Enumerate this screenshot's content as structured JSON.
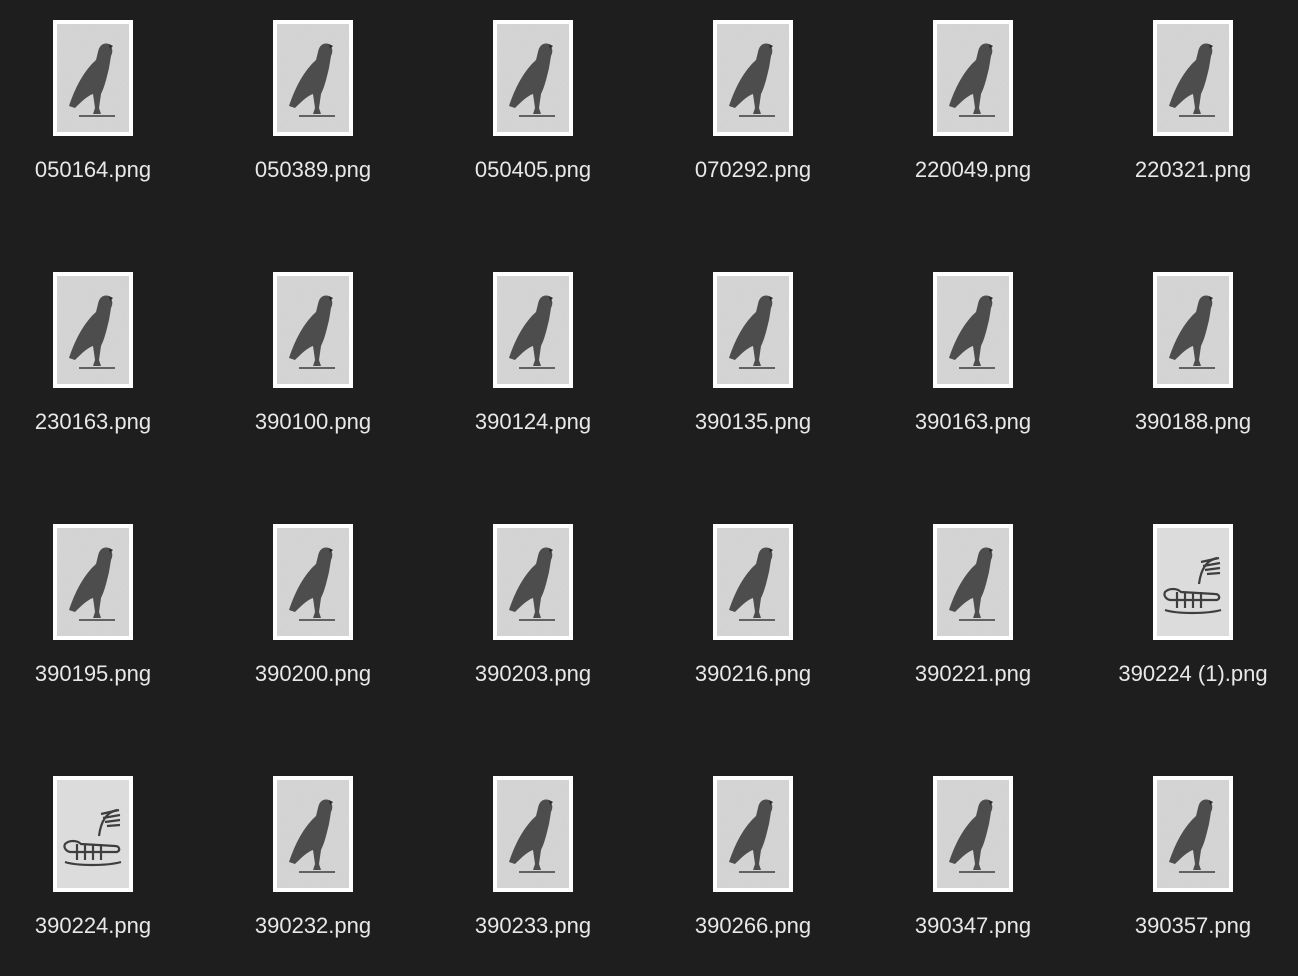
{
  "files": [
    {
      "name": "050164.png",
      "glyph": "falcon"
    },
    {
      "name": "050389.png",
      "glyph": "falcon"
    },
    {
      "name": "050405.png",
      "glyph": "falcon"
    },
    {
      "name": "070292.png",
      "glyph": "falcon"
    },
    {
      "name": "220049.png",
      "glyph": "falcon"
    },
    {
      "name": "220321.png",
      "glyph": "falcon"
    },
    {
      "name": "230163.png",
      "glyph": "falcon"
    },
    {
      "name": "390100.png",
      "glyph": "falcon"
    },
    {
      "name": "390124.png",
      "glyph": "falcon"
    },
    {
      "name": "390135.png",
      "glyph": "falcon"
    },
    {
      "name": "390163.png",
      "glyph": "falcon"
    },
    {
      "name": "390188.png",
      "glyph": "falcon"
    },
    {
      "name": "390195.png",
      "glyph": "falcon"
    },
    {
      "name": "390200.png",
      "glyph": "falcon"
    },
    {
      "name": "390203.png",
      "glyph": "falcon"
    },
    {
      "name": "390216.png",
      "glyph": "falcon"
    },
    {
      "name": "390221.png",
      "glyph": "falcon"
    },
    {
      "name": "390224 (1).png",
      "glyph": "sledge"
    },
    {
      "name": "390224.png",
      "glyph": "sledge"
    },
    {
      "name": "390232.png",
      "glyph": "falcon"
    },
    {
      "name": "390233.png",
      "glyph": "falcon"
    },
    {
      "name": "390266.png",
      "glyph": "falcon"
    },
    {
      "name": "390347.png",
      "glyph": "falcon"
    },
    {
      "name": "390357.png",
      "glyph": "falcon"
    }
  ]
}
